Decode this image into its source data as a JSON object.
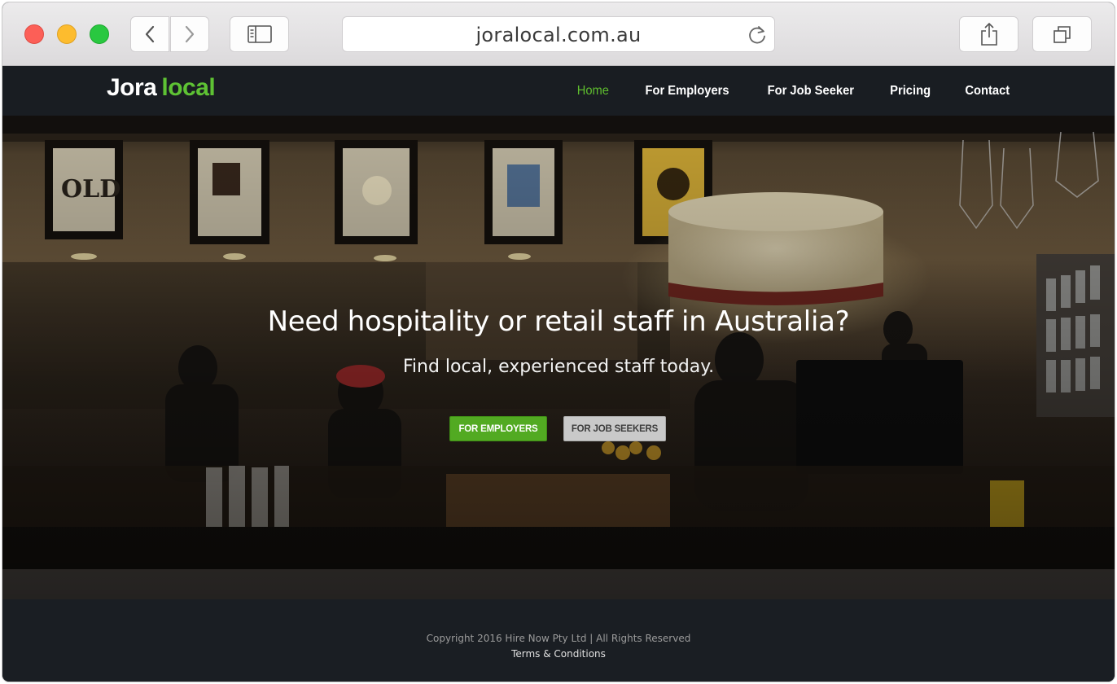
{
  "browser": {
    "url": "joralocal.com.au"
  },
  "site": {
    "logo": {
      "part1": "Jora",
      "part2": "local"
    },
    "nav": {
      "home": "Home",
      "employers": "For Employers",
      "job_seeker": "For Job Seeker",
      "pricing": "Pricing",
      "contact": "Contact"
    },
    "hero": {
      "title": "Need hospitality or retail staff in Australia?",
      "subtitle": "Find local, experienced staff today.",
      "employers_button": "FOR EMPLOYERS",
      "job_seekers_button": "FOR JOB SEEKERS"
    },
    "footer": {
      "copyright": "Copyright 2016 Hire Now Pty Ltd | All Rights Reserved",
      "terms": "Terms & Conditions"
    }
  },
  "colors": {
    "brand_green": "#5ec234",
    "nav_active": "#5fbf2e",
    "header_bg": "#191d22",
    "button_green": "#52aa22"
  },
  "icons": {
    "back": "chevron-left-icon",
    "forward": "chevron-right-icon",
    "sidebar": "sidebar-icon",
    "reload": "reload-icon",
    "share": "share-icon",
    "tabs": "tabs-icon",
    "logo_pin": "location-pin-icon"
  }
}
